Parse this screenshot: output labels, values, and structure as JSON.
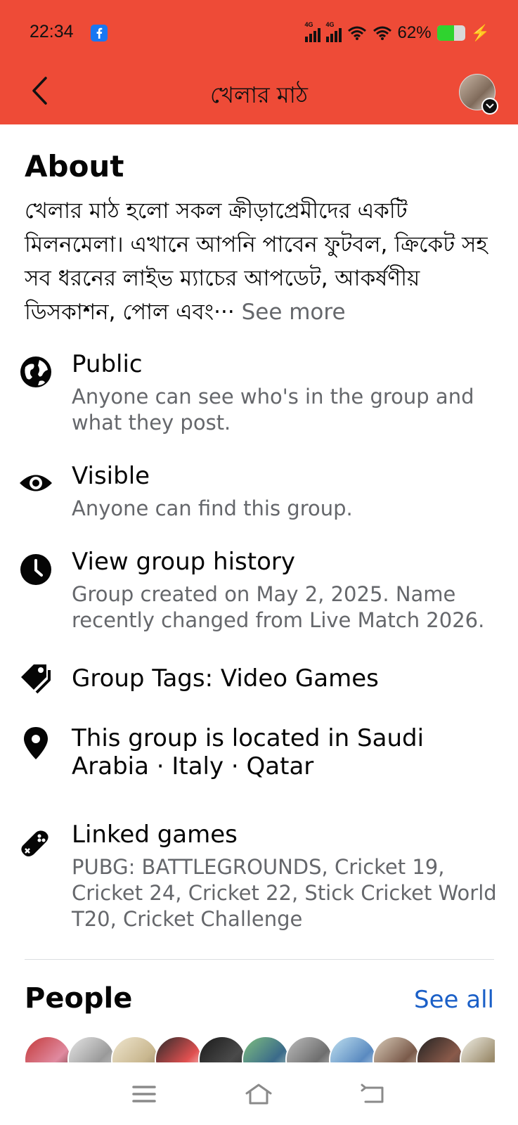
{
  "status_bar": {
    "time": "22:34",
    "network_1": "4G",
    "network_2": "4G",
    "battery_percent": "62%",
    "battery_level": 0.62,
    "app_icon": "facebook-icon"
  },
  "header": {
    "title": "খেলার মাঠ",
    "back_icon": "chevron-left-icon",
    "background_color": "#ee4b37"
  },
  "about": {
    "heading": "About",
    "description": "খেলার মাঠ হলো সকল ক্রীড়াপ্রেমীদের একটি মিলনমেলা। এখানে আপনি পাবেন ফুটবল, ক্রিকেট সহ সব ধরনের লাইভ ম্যাচের আপডেট, আকর্ষণীয় ডিসকাশন, পোল এবং···",
    "see_more": "See more"
  },
  "info_rows": [
    {
      "icon": "globe-icon",
      "title": "Public",
      "subtitle": "Anyone can see who's in the group and what they post."
    },
    {
      "icon": "eye-icon",
      "title": "Visible",
      "subtitle": "Anyone can find this group."
    },
    {
      "icon": "clock-icon",
      "title": "View group history",
      "subtitle": "Group created on May 2, 2025. Name recently changed from Live Match 2026."
    },
    {
      "icon": "tag-icon",
      "title": "Group Tags: Video Games",
      "subtitle": ""
    },
    {
      "icon": "location-pin-icon",
      "title": "This group is located in Saudi Arabia · Italy · Qatar",
      "subtitle": ""
    },
    {
      "icon": "gamepad-icon",
      "title": "Linked games",
      "subtitle": "PUBG: BATTLEGROUNDS, Cricket 19, Cricket 24, Cricket 22, Stick Cricket World T20, Cricket Challenge"
    }
  ],
  "people": {
    "heading": "People",
    "see_all": "See all"
  },
  "nav": {
    "menu_icon": "menu-icon",
    "home_icon": "home-icon",
    "back_icon": "back-arrow-icon"
  },
  "colors": {
    "accent": "#ee4b37",
    "link": "#1a5fc7",
    "secondary_text": "#65676b"
  }
}
